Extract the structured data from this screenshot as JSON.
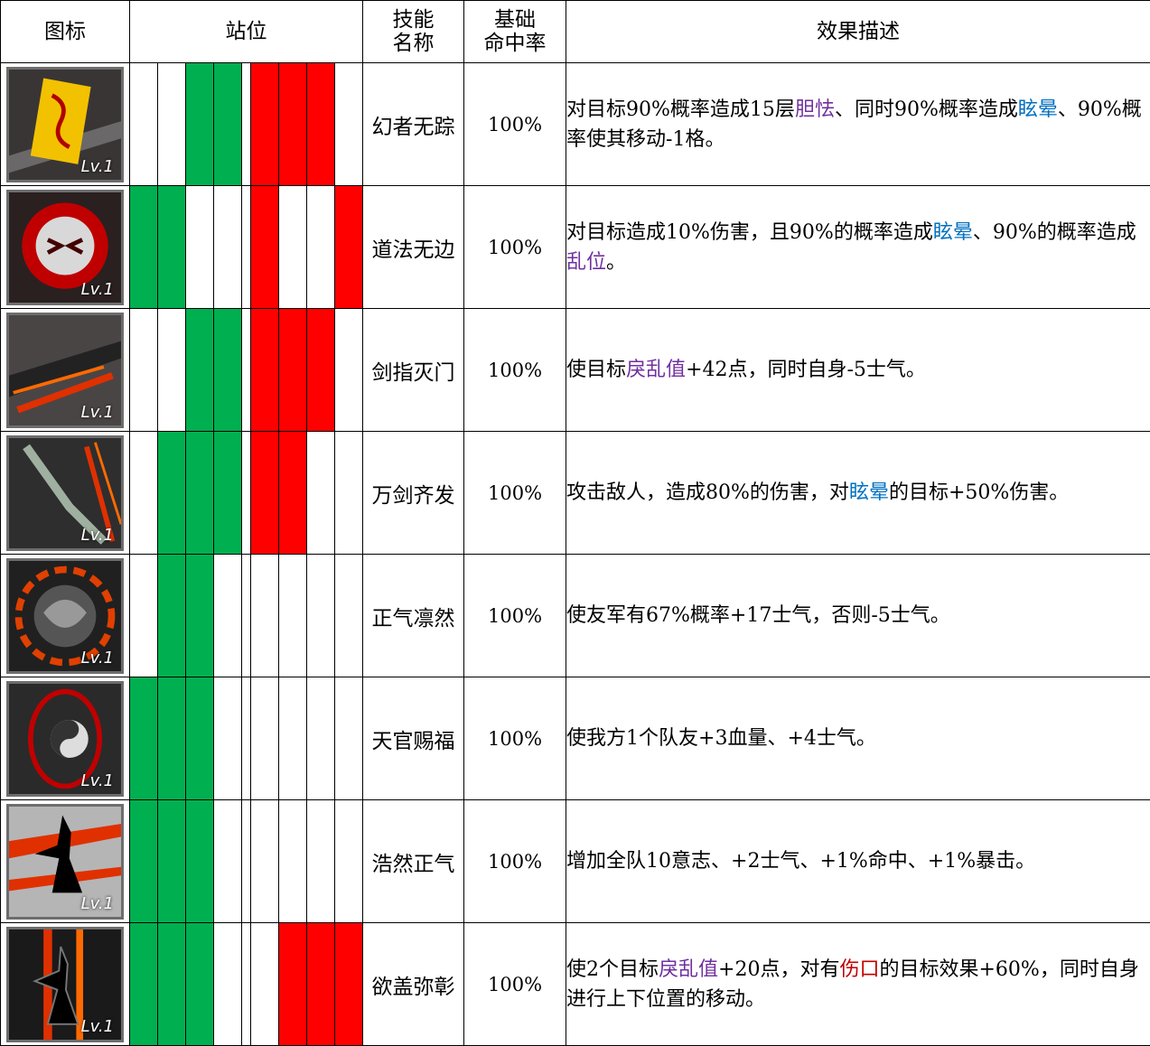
{
  "header": {
    "icon": "图标",
    "position": "站位",
    "skill_name_1": "技能",
    "skill_name_2": "名称",
    "hit_rate_1": "基础",
    "hit_rate_2": "命中率",
    "effect": "效果描述"
  },
  "colors": {
    "green": "#00b050",
    "red": "#ff0000",
    "purple": "#7030a0",
    "blue": "#0070c0",
    "darkred": "#c00000"
  },
  "skills": [
    {
      "icon": "yellow-talisman-icon",
      "level": "Lv.1",
      "positions_left": [
        0,
        0,
        1,
        1
      ],
      "positions_right": [
        1,
        1,
        1,
        0
      ],
      "name": "幻者无踪",
      "rate": "100%",
      "desc": [
        {
          "t": "对目标90%概率造成15层"
        },
        {
          "t": "胆怯",
          "c": "purple"
        },
        {
          "t": "、同时90%概率造成"
        },
        {
          "t": "眩晕",
          "c": "blue"
        },
        {
          "t": "、90%概率使其移动-1格。"
        }
      ]
    },
    {
      "icon": "demon-face-icon",
      "level": "Lv.1",
      "positions_left": [
        1,
        1,
        0,
        0
      ],
      "positions_right": [
        1,
        0,
        0,
        1
      ],
      "name": "道法无边",
      "rate": "100%",
      "desc": [
        {
          "t": "对目标造成10%伤害，且90%的概率造成"
        },
        {
          "t": "眩晕",
          "c": "blue"
        },
        {
          "t": "、90%的概率造成"
        },
        {
          "t": "乱位",
          "c": "purple"
        },
        {
          "t": "。"
        }
      ]
    },
    {
      "icon": "sword-strike-icon",
      "level": "Lv.1",
      "positions_left": [
        0,
        0,
        1,
        1
      ],
      "positions_right": [
        1,
        1,
        1,
        0
      ],
      "name": "剑指灭门",
      "rate": "100%",
      "desc": [
        {
          "t": "使目标"
        },
        {
          "t": "戾乱值",
          "c": "purple"
        },
        {
          "t": "+42点，同时自身-5士气。"
        }
      ]
    },
    {
      "icon": "sword-volley-icon",
      "level": "Lv.1",
      "positions_left": [
        0,
        1,
        1,
        1
      ],
      "positions_right": [
        1,
        1,
        0,
        0
      ],
      "name": "万剑齐发",
      "rate": "100%",
      "desc": [
        {
          "t": "攻击敌人，造成80%的伤害，对"
        },
        {
          "t": "眩晕",
          "c": "blue"
        },
        {
          "t": "的目标+50%伤害。"
        }
      ]
    },
    {
      "icon": "vortex-icon",
      "level": "Lv.1",
      "positions_left": [
        0,
        1,
        1,
        0
      ],
      "positions_right": [
        0,
        0,
        0,
        0
      ],
      "name": "正气凛然",
      "rate": "100%",
      "desc": [
        {
          "t": "使友军有67%概率+17士气，否则-5士气。"
        }
      ]
    },
    {
      "icon": "yin-yang-icon",
      "level": "Lv.1",
      "positions_left": [
        1,
        1,
        1,
        0
      ],
      "positions_right": [
        0,
        0,
        0,
        0
      ],
      "name": "天官赐福",
      "rate": "100%",
      "desc": [
        {
          "t": "使我方1个队友+3血量、+4士气。"
        }
      ]
    },
    {
      "icon": "dancer-silhouette-icon",
      "level": "Lv.1",
      "positions_left": [
        1,
        1,
        1,
        0
      ],
      "positions_right": [
        0,
        0,
        0,
        0
      ],
      "name": "浩然正气",
      "rate": "100%",
      "desc": [
        {
          "t": "增加全队10意志、+2士气、+1%命中、+1%暴击。"
        }
      ]
    },
    {
      "icon": "swordsman-silhouette-icon",
      "level": "Lv.1",
      "positions_left": [
        1,
        1,
        1,
        0
      ],
      "positions_right": [
        0,
        1,
        1,
        1
      ],
      "name": "欲盖弥彰",
      "rate": "100%",
      "desc": [
        {
          "t": "使2个目标"
        },
        {
          "t": "戾乱值",
          "c": "purple"
        },
        {
          "t": "+20点，对有"
        },
        {
          "t": "伤口",
          "c": "darkred"
        },
        {
          "t": "的目标效果+60%，同时自身进行上下位置的移动。"
        }
      ]
    }
  ]
}
